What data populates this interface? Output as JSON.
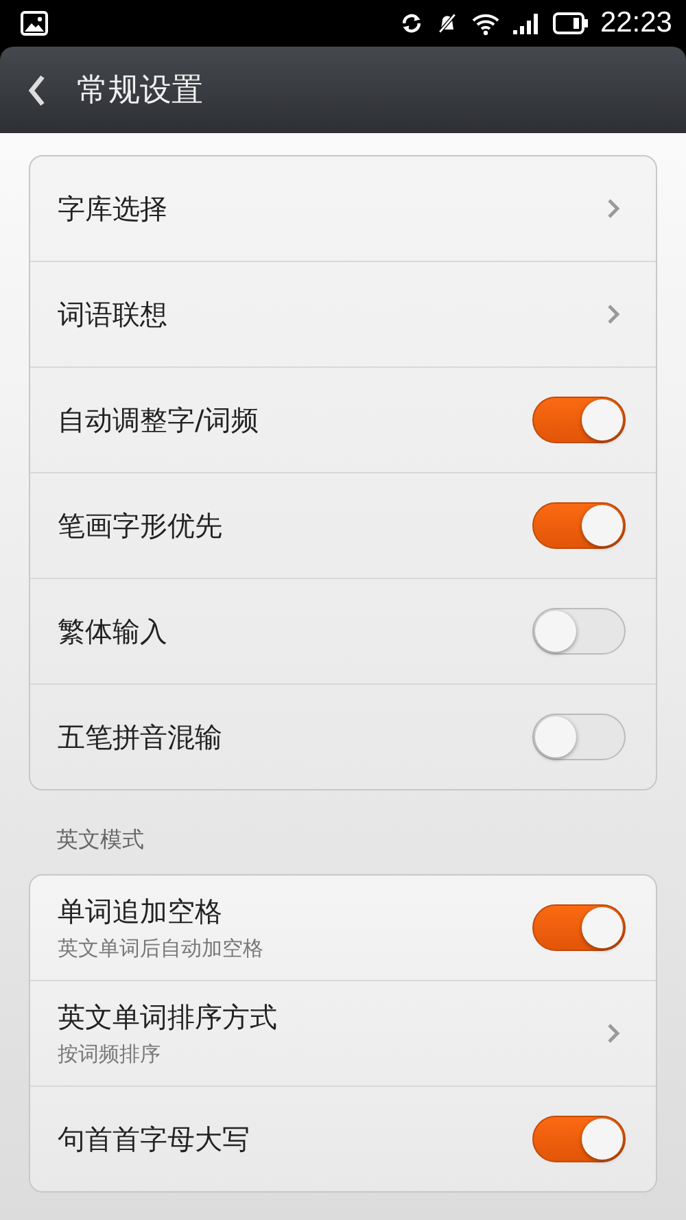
{
  "status_bar": {
    "time": "22:23"
  },
  "header": {
    "title": "常规设置"
  },
  "groups": [
    {
      "items": [
        {
          "kind": "nav",
          "label": "字库选择"
        },
        {
          "kind": "nav",
          "label": "词语联想"
        },
        {
          "kind": "toggle",
          "label": "自动调整字/词频",
          "on": true
        },
        {
          "kind": "toggle",
          "label": "笔画字形优先",
          "on": true
        },
        {
          "kind": "toggle",
          "label": "繁体输入",
          "on": false
        },
        {
          "kind": "toggle",
          "label": "五笔拼音混输",
          "on": false
        }
      ]
    },
    {
      "heading": "英文模式",
      "items": [
        {
          "kind": "toggle",
          "label": "单词追加空格",
          "subtitle": "英文单词后自动加空格",
          "on": true
        },
        {
          "kind": "nav",
          "label": "英文单词排序方式",
          "subtitle": "按词频排序"
        },
        {
          "kind": "toggle",
          "label": "句首首字母大写",
          "on": true
        }
      ]
    }
  ]
}
